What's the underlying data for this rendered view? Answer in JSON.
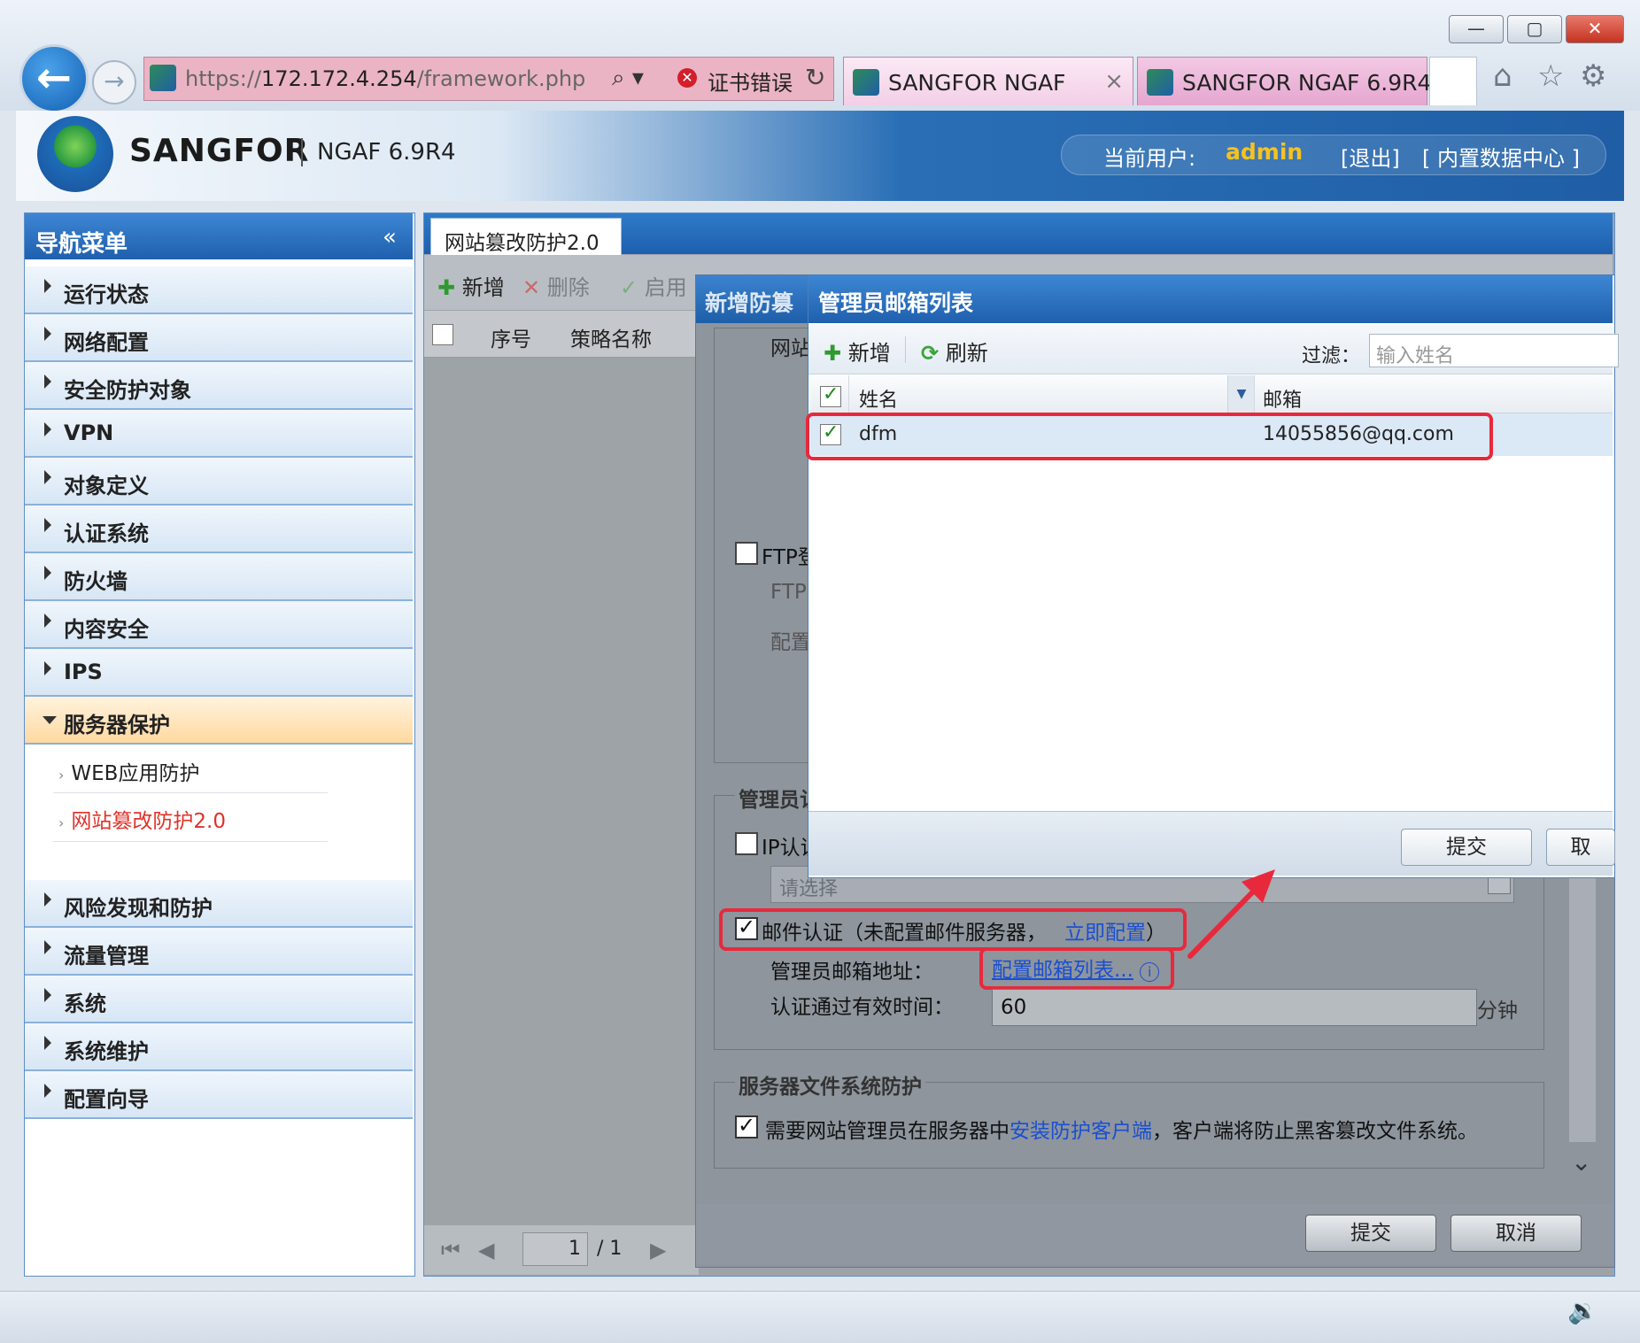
{
  "browser": {
    "url_prefix": "https://",
    "url_host": "172.172.4.254",
    "url_path": "/framework.php",
    "search_glyph": "⌕ ▾",
    "cert_error": "证书错误",
    "tabs": [
      {
        "label": "SANGFOR NGAF",
        "close": "×"
      },
      {
        "label": "SANGFOR NGAF 6.9R4"
      }
    ],
    "window_buttons": [
      "—",
      "▢",
      "✕"
    ],
    "toolbar_icons": [
      "home-icon",
      "star-icon",
      "gear-icon"
    ]
  },
  "header": {
    "brand": "SANGFOR",
    "product": "NGAF 6.9R4",
    "user_label": "当前用户:",
    "username": "admin",
    "logout": "[退出]",
    "datacenter": "[ 内置数据中心 ]"
  },
  "nav": {
    "title": "导航菜单",
    "collapse": "«",
    "items": [
      {
        "label": "运行状态"
      },
      {
        "label": "网络配置"
      },
      {
        "label": "安全防护对象"
      },
      {
        "label": "VPN"
      },
      {
        "label": "对象定义"
      },
      {
        "label": "认证系统"
      },
      {
        "label": "防火墙"
      },
      {
        "label": "内容安全"
      },
      {
        "label": "IPS"
      },
      {
        "label": "服务器保护"
      },
      {
        "label": "风险发现和防护"
      },
      {
        "label": "流量管理"
      },
      {
        "label": "系统"
      },
      {
        "label": "系统维护"
      },
      {
        "label": "配置向导"
      }
    ],
    "subitems": [
      {
        "label": "WEB应用防护"
      },
      {
        "label": "网站篡改防护2.0"
      }
    ]
  },
  "main": {
    "tab": "网站篡改防护2.0",
    "toolbar": {
      "add": "新增",
      "delete": "删除",
      "enable": "启用"
    },
    "columns": {
      "seq": "序号",
      "name": "策略名称"
    },
    "pager": {
      "page": "1",
      "total": "/ 1"
    }
  },
  "dialog_bg": {
    "title": "新增防篡",
    "fragment_site": "网站",
    "ftp_check": "FTP登",
    "ftp_label": "FTP",
    "config_label": "配置",
    "admin_group": "管理员认",
    "ip_auth": "IP认证",
    "select_placeholder": "请选择",
    "mail_auth_text": "邮件认证（未配置邮件服务器，",
    "mail_auth_link": "立即配置",
    "mail_auth_close": "）",
    "admin_mail_label": "管理员邮箱地址：",
    "config_mail_link": "配置邮箱列表...",
    "info_glyph": "i",
    "valid_time_label": "认证通过有效时间：",
    "valid_time_value": "60",
    "minutes": "分钟",
    "fs_group": "服务器文件系统防护",
    "fs_text_pre": "需要网站管理员在服务器中",
    "fs_link": "安装防护客户端",
    "fs_text_post": "，客户端将防止黑客篡改文件系统。",
    "submit": "提交",
    "cancel": "取消"
  },
  "dialog_mail": {
    "title": "管理员邮箱列表",
    "add": "新增",
    "refresh": "刷新",
    "filter_label": "过滤：",
    "filter_placeholder": "输入姓名",
    "col_name": "姓名",
    "col_email": "邮箱",
    "rows": [
      {
        "name": "dfm",
        "email": "14055856@qq.com"
      }
    ],
    "submit": "提交",
    "cancel": "取"
  },
  "colors": {
    "accent_blue": "#1f60ad",
    "highlight_red": "#e8293c",
    "username_gold": "#f7c21e",
    "link_blue": "#1a4fd0"
  }
}
